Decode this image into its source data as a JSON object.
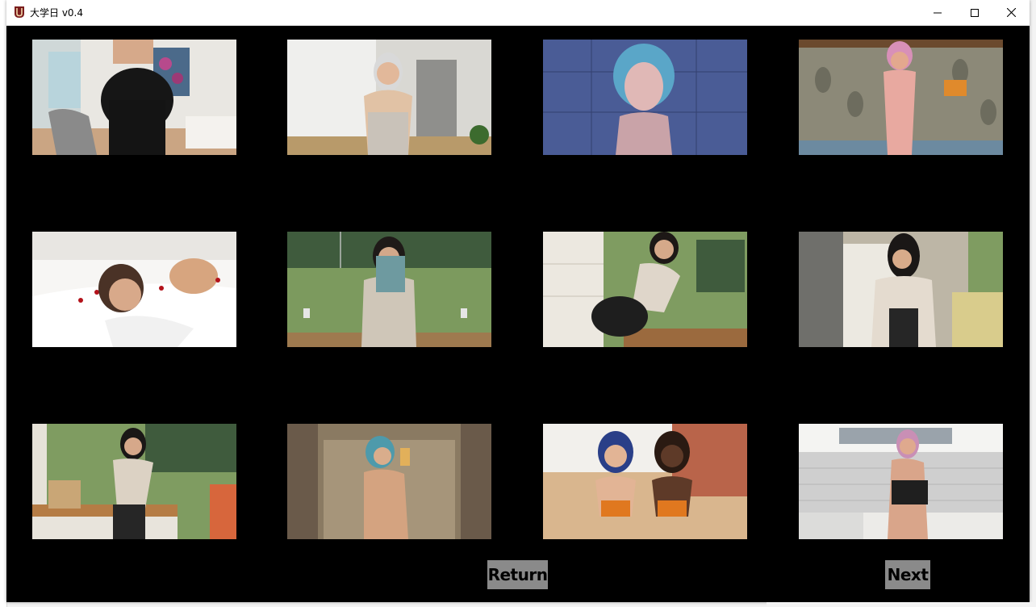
{
  "window": {
    "title": "大学日 v0.4",
    "app_icon": "app-logo-icon",
    "controls": [
      "minimize-icon",
      "maximize-icon",
      "close-icon"
    ]
  },
  "gallery": {
    "thumbnails": [
      {
        "row": 1,
        "col": 1,
        "scene": "office-woman-back"
      },
      {
        "row": 1,
        "col": 2,
        "scene": "teacher-whiteboard"
      },
      {
        "row": 1,
        "col": 3,
        "scene": "blue-hair-girl-floor"
      },
      {
        "row": 1,
        "col": 4,
        "scene": "pink-hair-woman-room"
      },
      {
        "row": 2,
        "col": 1,
        "scene": "woman-bathtub"
      },
      {
        "row": 2,
        "col": 2,
        "scene": "teacher-notebook-classroom"
      },
      {
        "row": 2,
        "col": 3,
        "scene": "teacher-desk-classroom"
      },
      {
        "row": 2,
        "col": 4,
        "scene": "teacher-library-shelves"
      },
      {
        "row": 3,
        "col": 1,
        "scene": "teacher-sitting-desk"
      },
      {
        "row": 3,
        "col": 2,
        "scene": "mirror-selfie"
      },
      {
        "row": 3,
        "col": 3,
        "scene": "two-cheerleaders"
      },
      {
        "row": 3,
        "col": 4,
        "scene": "pink-hair-kitchen"
      }
    ]
  },
  "buttons": {
    "return_label": "Return",
    "next_label": "Next"
  },
  "colors": {
    "background": "#000000",
    "button_bg": "#8a8a8a"
  }
}
